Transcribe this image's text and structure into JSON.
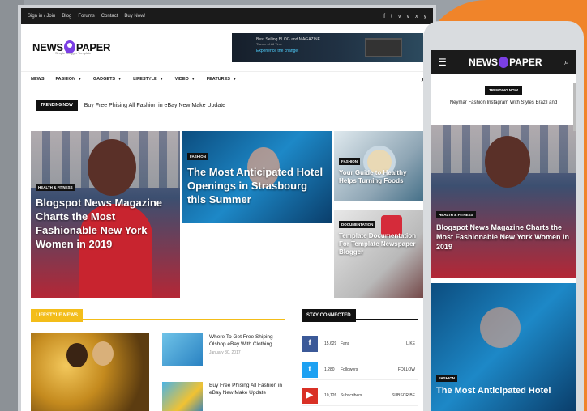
{
  "topbar": {
    "links": [
      "Sign in / Join",
      "Blog",
      "Forums",
      "Contact",
      "Buy Now!"
    ],
    "social": [
      "f",
      "t",
      "v",
      "v",
      "x",
      "y"
    ]
  },
  "logo": {
    "news": "NEWS",
    "paper": "PAPER",
    "tagline": "Simple Blogger Template"
  },
  "ad": {
    "line1": "Best Selling BLOG and MAGAZINE",
    "line2": "Theme of All Time",
    "line3": "Experience the change!"
  },
  "nav": {
    "items": [
      "NEWS",
      "FASHION",
      "GADGETS",
      "LIFESTYLE",
      "VIDEO",
      "FEATURES"
    ]
  },
  "trending": {
    "badge": "TRENDING NOW",
    "text": "Buy Free Phising All Fashion in eBay New Make Update"
  },
  "tiles": [
    {
      "tag": "HEALTH & FITNESS",
      "title": "Blogspot News Magazine Charts the Most Fashionable New York Women in 2019"
    },
    {
      "tag": "FASHION",
      "title": "The Most Anticipated Hotel Openings in Strasbourg this Summer"
    },
    {
      "tag": "FASHION",
      "title": "Your Guide to Healthy Helps Turning Foods"
    },
    {
      "tag": "DOCUMENTATION",
      "title": "Template Documentation For Template Newspaper Blogger"
    }
  ],
  "sections": {
    "lifestyle": "LIFESTYLE NEWS",
    "stay": "STAY CONNECTED"
  },
  "list": [
    {
      "title": "Where To Get Free Shiping Olshop eBay With Clothing",
      "date": "January 30, 2017"
    },
    {
      "title": "Buy Free Phising All Fashion in eBay New Make Update",
      "date": ""
    }
  ],
  "social_counters": [
    {
      "icon": "f",
      "count": "15,629",
      "label": "Fans",
      "action": "LIKE"
    },
    {
      "icon": "t",
      "count": "1,280",
      "label": "Followers",
      "action": "FOLLOW"
    },
    {
      "icon": "▶",
      "count": "10,126",
      "label": "Subscribers",
      "action": "SUBSCRIBE"
    }
  ],
  "mobile": {
    "logo": {
      "news": "NEWS",
      "paper": "PAPER"
    },
    "trending_badge": "TRENDING NOW",
    "trending_text": "Neymar Fashion Instagram With Styles Brazil and",
    "tile1": {
      "tag": "HEALTH & FITNESS",
      "title": "Blogspot News Magazine Charts the Most Fashionable New York Women in 2019"
    },
    "tile2": {
      "tag": "FASHION",
      "title": "The Most Anticipated Hotel"
    }
  },
  "colors": {
    "accent_yellow": "#f3bd19",
    "orange_bg": "#f0842a",
    "brand_purple": "#7b3fe4"
  }
}
